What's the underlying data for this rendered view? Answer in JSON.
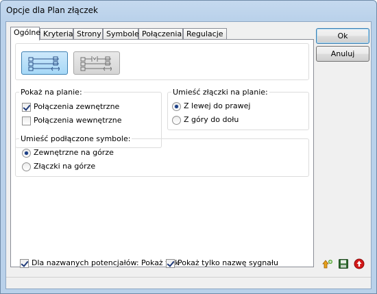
{
  "window": {
    "title": "Opcje dla Plan złączek"
  },
  "tabs": [
    {
      "label": "Ogólne",
      "active": true
    },
    {
      "label": "Kryteria"
    },
    {
      "label": "Strony"
    },
    {
      "label": "Symbole"
    },
    {
      "label": "Połączenia"
    },
    {
      "label": "Regulacje"
    }
  ],
  "layout_buttons": {
    "selected": "first",
    "icons": [
      "terminal-layout-stacked-icon",
      "terminal-layout-connected-icon"
    ]
  },
  "show_group": {
    "title": "Pokaż na planie:",
    "items": [
      {
        "label": "Połączenia zewnętrzne",
        "checked": true
      },
      {
        "label": "Połączenia wewnętrzne",
        "checked": false
      }
    ]
  },
  "place_terminals_group": {
    "title": "Umieść złączki na planie:",
    "items": [
      {
        "label": "Z lewej do prawej",
        "selected": true
      },
      {
        "label": "Z góry do dołu",
        "selected": false
      }
    ]
  },
  "place_symbols_group": {
    "title": "Umieść podłączone symbole:",
    "items": [
      {
        "label": "Zewnętrzne na górze",
        "selected": true
      },
      {
        "label": "Złączki na górze",
        "selected": false
      }
    ]
  },
  "bottom_options": [
    {
      "label": "Dla nazwanych potencjałów: Pokaż tylk",
      "checked": true
    },
    {
      "label": "Pokaż tylko nazwę sygnału",
      "checked": true
    }
  ],
  "buttons": {
    "ok": "Ok",
    "cancel": "Anuluj"
  },
  "bottom_icons": [
    "import-icon",
    "save-icon",
    "upload-icon"
  ],
  "colors": {
    "accent": "#3c7fb1",
    "title_bg": "#b9d1ea"
  }
}
